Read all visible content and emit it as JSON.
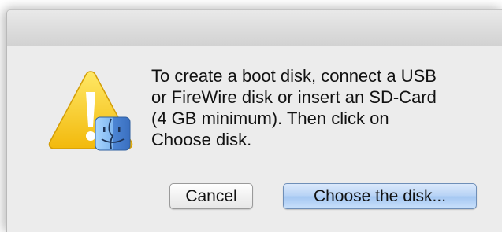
{
  "dialog": {
    "message": "To create a boot disk, connect a USB\nor FireWire disk or insert an SD-Card\n(4 GB minimum). Then click on\nChoose disk.",
    "icon": "caution-icon-with-finder-badge",
    "buttons": {
      "cancel_label": "Cancel",
      "choose_label": "Choose the disk..."
    },
    "colors": {
      "warning_yellow": "#f7c81e",
      "default_button": "#b6d2f5",
      "finder_blue": "#5a8fd8"
    }
  }
}
